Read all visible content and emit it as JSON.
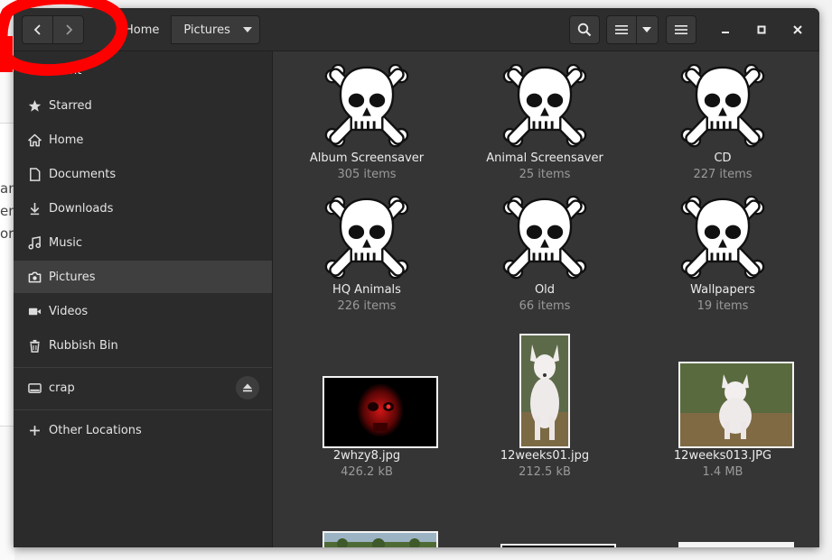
{
  "background": {
    "text_lines": [
      "am",
      "em",
      "ore"
    ]
  },
  "header": {
    "back_label": "<",
    "forward_label": ">",
    "breadcrumbs": [
      "Home",
      "Pictures"
    ],
    "icons": [
      "chevron-left-icon",
      "chevron-right-icon",
      "search-icon",
      "list-view-icon",
      "chevron-down-icon",
      "hamburger-menu-icon",
      "minimize-icon",
      "maximize-icon",
      "close-icon"
    ]
  },
  "sidebar": {
    "partial_top_label": "nt",
    "items": [
      {
        "label": "Starred",
        "icon": "star-icon"
      },
      {
        "label": "Home",
        "icon": "home-icon"
      },
      {
        "label": "Documents",
        "icon": "document-icon"
      },
      {
        "label": "Downloads",
        "icon": "download-icon"
      },
      {
        "label": "Music",
        "icon": "music-icon"
      },
      {
        "label": "Pictures",
        "icon": "camera-icon",
        "selected": true
      },
      {
        "label": "Videos",
        "icon": "video-camera-icon"
      },
      {
        "label": "Rubbish Bin",
        "icon": "trash-icon"
      }
    ],
    "device": {
      "label": "crap",
      "icon": "drive-icon"
    },
    "other": {
      "label": "Other Locations",
      "icon": "plus-icon"
    }
  },
  "files": {
    "folders": [
      {
        "name": "Album Screensaver",
        "count": "305 items"
      },
      {
        "name": "Animal Screensaver",
        "count": "25 items"
      },
      {
        "name": "CD",
        "count": "227 items"
      },
      {
        "name": "HQ Animals",
        "count": "226 items"
      },
      {
        "name": "Old",
        "count": "66 items"
      },
      {
        "name": "Wallpapers",
        "count": "19 items"
      }
    ],
    "images": [
      {
        "name": "2whzy8.jpg",
        "size": "426.2 kB"
      },
      {
        "name": "12weeks01.jpg",
        "size": "212.5 kB"
      },
      {
        "name": "12weeks013.JPG",
        "size": "1.4 MB"
      }
    ]
  },
  "colors": {
    "window_bg": "#353535",
    "sidebar_bg": "#2b2b2b",
    "selected_bg": "#3f3f3f",
    "annotation_red": "#ff0000"
  }
}
